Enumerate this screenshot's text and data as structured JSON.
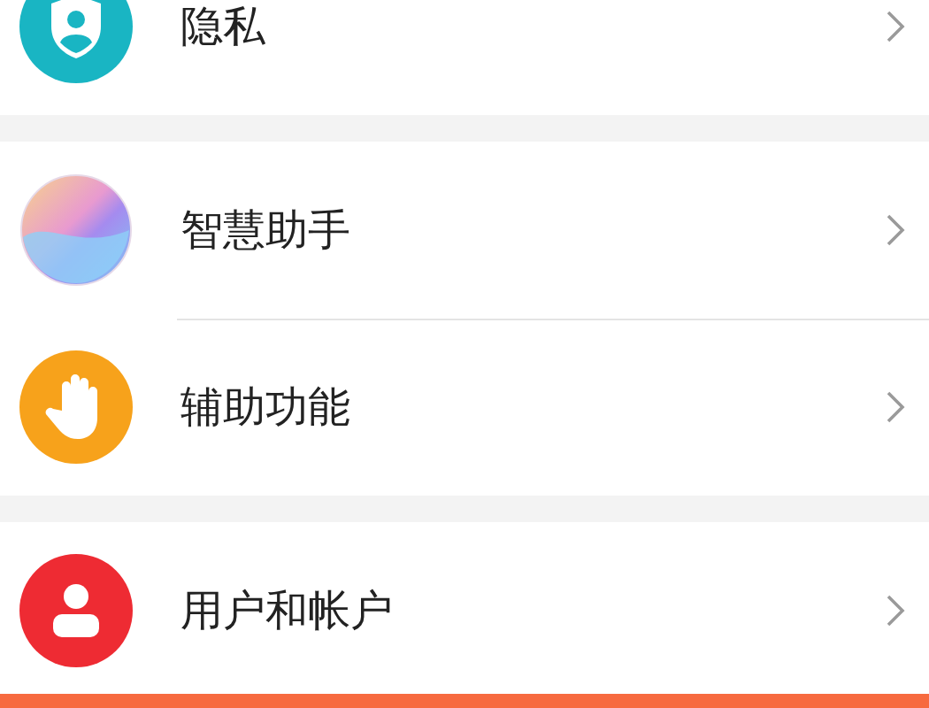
{
  "groups": [
    {
      "items": [
        {
          "label": "隐私"
        }
      ]
    },
    {
      "items": [
        {
          "label": "智慧助手"
        },
        {
          "label": "辅助功能"
        }
      ]
    },
    {
      "items": [
        {
          "label": "用户和帐户"
        }
      ]
    }
  ]
}
